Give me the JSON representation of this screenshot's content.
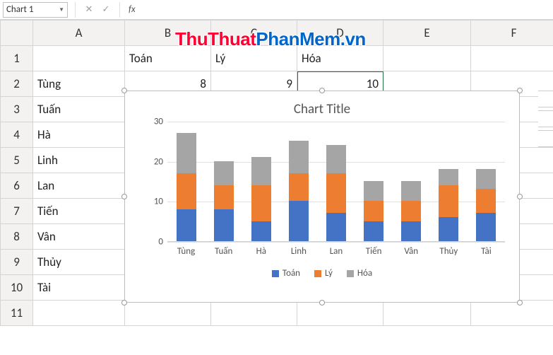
{
  "name_box": {
    "value": "Chart 1"
  },
  "formula_bar": {
    "cancel": "✕",
    "confirm": "✓",
    "fx": "fx",
    "value": ""
  },
  "watermark": {
    "part1": "ThuThuat",
    "part2": "PhanMem",
    "part3": ".vn"
  },
  "columns": [
    "A",
    "B",
    "C",
    "D",
    "E",
    "F"
  ],
  "rows": [
    "1",
    "2",
    "3",
    "4",
    "5",
    "6",
    "7",
    "8",
    "9",
    "10",
    "11"
  ],
  "cells": {
    "B1": "Toán",
    "C1": "Lý",
    "D1": "Hóa",
    "A2": "Tùng",
    "B2": "8",
    "C2": "9",
    "D2": "10",
    "A3": "Tuấn",
    "A4": "Hà",
    "A5": "Linh",
    "A6": "Lan",
    "A7": "Tiến",
    "A8": "Vân",
    "A9": "Thủy",
    "A10": "Tài"
  },
  "chart_data": {
    "type": "bar",
    "stacked": true,
    "title": "Chart Title",
    "xlabel": "",
    "ylabel": "",
    "ylim": [
      0,
      30
    ],
    "yticks": [
      0,
      10,
      20,
      30
    ],
    "categories": [
      "Tùng",
      "Tuấn",
      "Hà",
      "Linh",
      "Lan",
      "Tiến",
      "Vân",
      "Thủy",
      "Tài"
    ],
    "series": [
      {
        "name": "Toán",
        "color": "#4472c4",
        "values": [
          8,
          8,
          5,
          10,
          7,
          5,
          5,
          6,
          7
        ]
      },
      {
        "name": "Lý",
        "color": "#ed7d31",
        "values": [
          9,
          6,
          9,
          7,
          10,
          5,
          5,
          8,
          6
        ]
      },
      {
        "name": "Hóa",
        "color": "#a5a5a5",
        "values": [
          10,
          6,
          7,
          8,
          7,
          5,
          5,
          4,
          5
        ]
      }
    ],
    "legend_position": "bottom"
  }
}
